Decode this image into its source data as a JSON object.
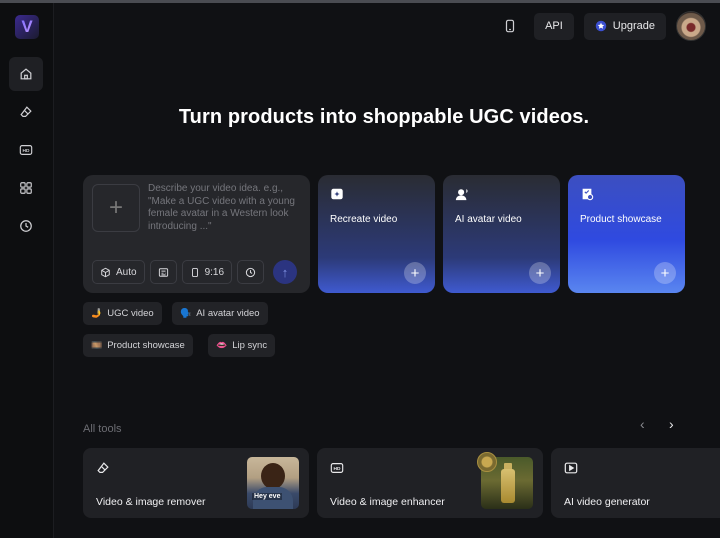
{
  "logo": {
    "letter": "V"
  },
  "sidebar": {
    "items": [
      {
        "name": "home",
        "icon": "home-icon"
      },
      {
        "name": "eraser",
        "icon": "eraser-icon"
      },
      {
        "name": "hd",
        "icon": "hd-icon"
      },
      {
        "name": "apps",
        "icon": "grid-icon"
      },
      {
        "name": "history",
        "icon": "clock-icon"
      }
    ]
  },
  "header": {
    "api_label": "API",
    "upgrade_label": "Upgrade"
  },
  "hero": {
    "title": "Turn products into shoppable UGC videos."
  },
  "prompt": {
    "placeholder": "Describe your video idea. e.g., \"Make a UGC video with a young female avatar in a Western look introducing ...\"",
    "mode_label": "Auto",
    "ratio_label": "9:16"
  },
  "feature_cards": [
    {
      "label": "Recreate video",
      "icon": "recreate-icon"
    },
    {
      "label": "AI avatar video",
      "icon": "avatar-icon"
    },
    {
      "label": "Product showcase",
      "icon": "showcase-icon"
    }
  ],
  "chips": [
    {
      "emoji": "🤳",
      "label": "UGC video"
    },
    {
      "emoji": "🗣️",
      "label": "AI avatar video"
    },
    {
      "emoji": "🎞️",
      "label": "Product showcase"
    },
    {
      "emoji": "👄",
      "label": "Lip sync"
    }
  ],
  "tools": {
    "heading": "All tools",
    "items": [
      {
        "label": "Video & image remover",
        "icon": "eraser-icon",
        "thumb_caption": "Hey eve"
      },
      {
        "label": "Video & image enhancer",
        "icon": "hd-icon"
      },
      {
        "label": "AI video generator",
        "icon": "play-icon"
      }
    ]
  },
  "colors": {
    "accent": "#3f5ad0",
    "background": "#101114",
    "card": "#202125"
  }
}
